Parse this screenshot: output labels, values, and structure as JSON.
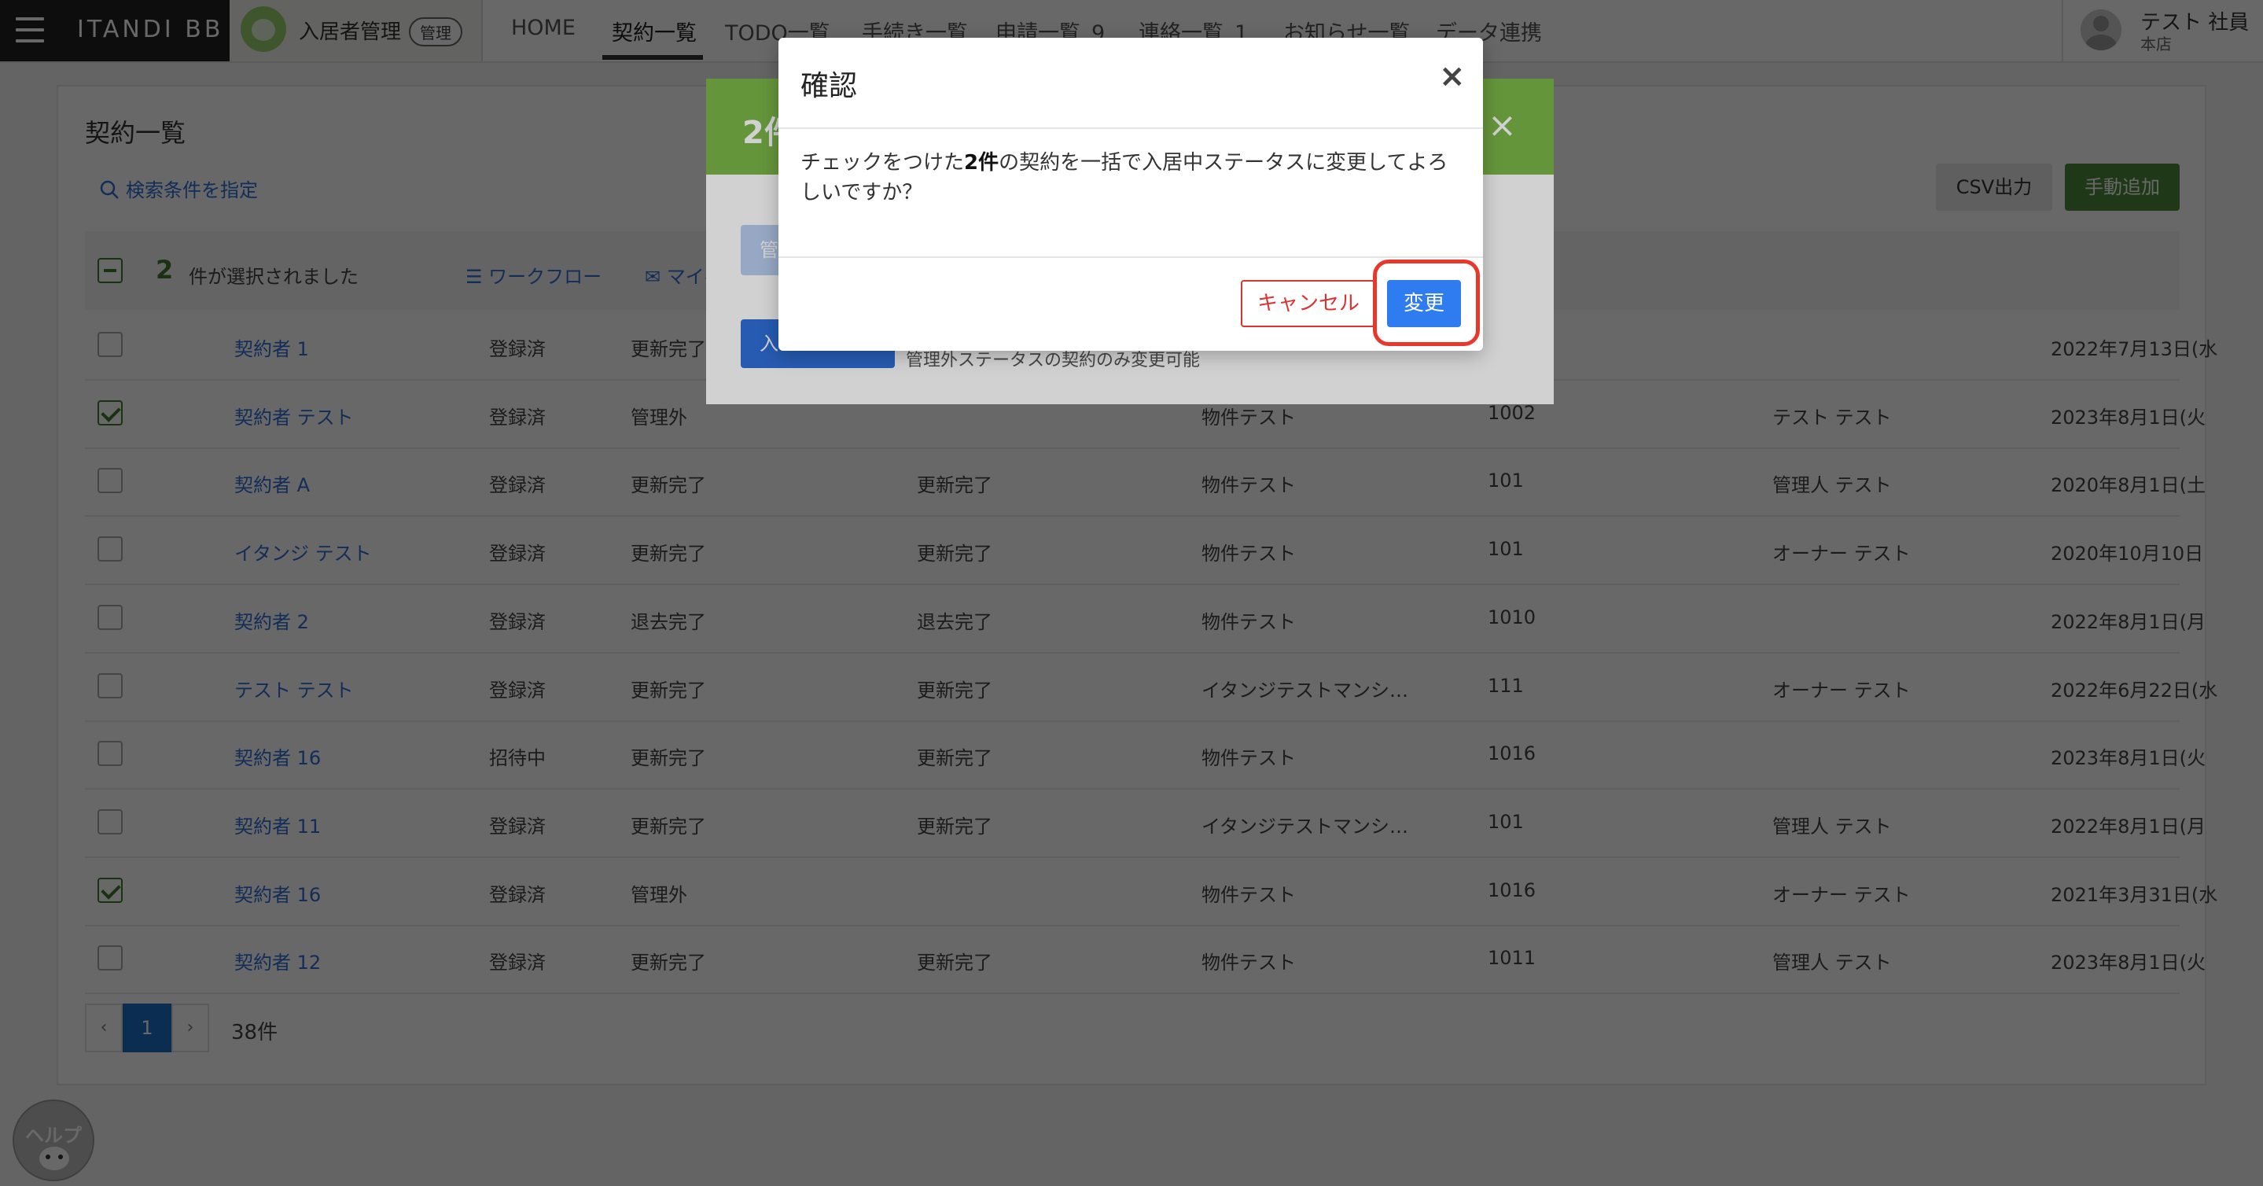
{
  "brand": {
    "name": "ITANDI BB"
  },
  "app": {
    "name": "入居者管理",
    "badge": "管理"
  },
  "nav": {
    "home": "HOME",
    "contracts": "契約一覧",
    "todo": "TODO一覧",
    "procedures": "手続き一覧",
    "applications": "申請一覧",
    "applications_count": "9",
    "contacts": "連絡一覧",
    "contacts_count": "1",
    "notices": "お知らせ一覧",
    "data_link": "データ連携"
  },
  "user": {
    "name": "テスト 社員",
    "store": "本店"
  },
  "page": {
    "title": "契約一覧",
    "search_link": "検索条件を指定",
    "csv_button": "CSV出力",
    "add_button": "手動追加"
  },
  "selection": {
    "count": "2",
    "text": "件が選択されました",
    "workflow": "ワークフロー",
    "mypage": "マイページ"
  },
  "table": {
    "rows": [
      {
        "checked": false,
        "name": "契約者 1",
        "reg": "登録済",
        "status": "更新完了",
        "status2": "",
        "property": "",
        "room": "",
        "owner": "",
        "date": "2022年7月13日(水"
      },
      {
        "checked": true,
        "name": "契約者 テスト",
        "reg": "登録済",
        "status": "管理外",
        "status2": "",
        "property": "物件テスト",
        "room": "1002",
        "owner": "テスト テスト",
        "date": "2023年8月1日(火"
      },
      {
        "checked": false,
        "name": "契約者 A",
        "reg": "登録済",
        "status": "更新完了",
        "status2": "更新完了",
        "property": "物件テスト",
        "room": "101",
        "owner": "管理人 テスト",
        "date": "2020年8月1日(土"
      },
      {
        "checked": false,
        "name": "イタンジ テスト",
        "reg": "登録済",
        "status": "更新完了",
        "status2": "更新完了",
        "property": "物件テスト",
        "room": "101",
        "owner": "オーナー テスト",
        "date": "2020年10月10日"
      },
      {
        "checked": false,
        "name": "契約者 2",
        "reg": "登録済",
        "status": "退去完了",
        "status2": "退去完了",
        "property": "物件テスト",
        "room": "1010",
        "owner": "",
        "date": "2022年8月1日(月"
      },
      {
        "checked": false,
        "name": "テスト テスト",
        "reg": "登録済",
        "status": "更新完了",
        "status2": "更新完了",
        "property": "イタンジテストマンシ…",
        "room": "111",
        "owner": "オーナー テスト",
        "date": "2022年6月22日(水"
      },
      {
        "checked": false,
        "name": "契約者 16",
        "reg": "招待中",
        "status": "更新完了",
        "status2": "更新完了",
        "property": "物件テスト",
        "room": "1016",
        "owner": "",
        "date": "2023年8月1日(火"
      },
      {
        "checked": false,
        "name": "契約者 11",
        "reg": "登録済",
        "status": "更新完了",
        "status2": "更新完了",
        "property": "イタンジテストマンシ…",
        "room": "101",
        "owner": "管理人 テスト",
        "date": "2022年8月1日(月"
      },
      {
        "checked": true,
        "name": "契約者 16",
        "reg": "登録済",
        "status": "管理外",
        "status2": "",
        "property": "物件テスト",
        "room": "1016",
        "owner": "オーナー テスト",
        "date": "2021年3月31日(水"
      },
      {
        "checked": false,
        "name": "契約者 12",
        "reg": "登録済",
        "status": "更新完了",
        "status2": "更新完了",
        "property": "物件テスト",
        "room": "1011",
        "owner": "管理人 テスト",
        "date": "2023年8月1日(火"
      }
    ]
  },
  "pager": {
    "prev": "‹",
    "current": "1",
    "next": "›",
    "total": "38件"
  },
  "bulk_modal": {
    "title": "2件",
    "close": "×",
    "button1": "管",
    "button2": "入",
    "note": "管理外ステータスの契約のみ変更可能"
  },
  "dialog": {
    "title": "確認",
    "close": "×",
    "body_pre": "チェックをつけた",
    "body_bold": "2件",
    "body_post": "の契約を一括で入居中ステータスに変更してよろしいですか？",
    "cancel": "キャンセル",
    "confirm": "変更"
  },
  "help": {
    "label": "ヘルプ"
  },
  "colors": {
    "accent": "#7ab648",
    "link": "#2f6fd8",
    "primary": "#2f7cf0",
    "danger": "#d33",
    "highlight": "#e8382b"
  }
}
